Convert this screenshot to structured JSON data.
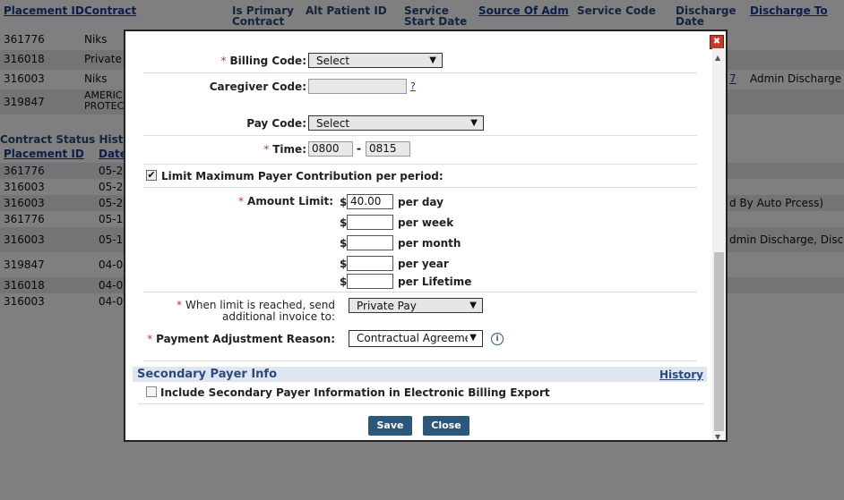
{
  "background": {
    "headers": [
      {
        "text": "Placement ID",
        "link": true
      },
      {
        "text": "Contract",
        "link": true
      },
      {
        "text": "Is Primary Contract",
        "link": false
      },
      {
        "text": "Alt Patient ID",
        "link": false
      },
      {
        "text": "Service Start Date",
        "link": false
      },
      {
        "text": "Source Of Adm",
        "link": true
      },
      {
        "text": "Service Code",
        "link": false
      },
      {
        "text": "Discharge Date",
        "link": false
      },
      {
        "text": "Discharge To",
        "link": true
      }
    ],
    "rows": [
      {
        "id": "361776",
        "contract": "Niks"
      },
      {
        "id": "316018",
        "contract": "Private"
      },
      {
        "id": "316003",
        "contract": "Niks",
        "extra": "7",
        "discharge_to": "Admin Discharge"
      },
      {
        "id": "319847",
        "contract": "AMERIC\nPROTEC"
      }
    ],
    "status_history_title": "Contract Status History",
    "status_headers": [
      "Placement ID",
      "Date"
    ],
    "status_rows": [
      {
        "id": "361776",
        "date": "05-2"
      },
      {
        "id": "316003",
        "date": "05-2"
      },
      {
        "id": "316003",
        "date": "05-2",
        "note": "d By Auto Prcess)"
      },
      {
        "id": "361776",
        "date": "05-1"
      },
      {
        "id": "316003",
        "date": "05-1",
        "note": "dmin Discharge, Disch"
      },
      {
        "id": "319847",
        "date": "04-0"
      },
      {
        "id": "316018",
        "date": "04-0"
      },
      {
        "id": "316003",
        "date": "04-0"
      }
    ]
  },
  "modal": {
    "close_glyph": "✖",
    "billing_code": {
      "label": "Billing Code:",
      "value": "Select"
    },
    "caregiver_code": {
      "label": "Caregiver Code:",
      "value": "",
      "help": "?"
    },
    "pay_code": {
      "label": "Pay Code:",
      "value": "Select"
    },
    "time": {
      "label": "Time:",
      "start": "0800",
      "separator": "-",
      "end": "0815"
    },
    "limit_checkbox": {
      "label": "Limit Maximum Payer Contribution per period:",
      "checked": true
    },
    "amount_limit": {
      "label": "Amount Limit:",
      "currency": "$",
      "rows": [
        {
          "period": "per day",
          "value": "40.00"
        },
        {
          "period": "per week",
          "value": ""
        },
        {
          "period": "per month",
          "value": ""
        },
        {
          "period": "per year",
          "value": ""
        },
        {
          "period": "per Lifetime",
          "value": ""
        }
      ]
    },
    "limit_reached": {
      "label_line1": "When limit is reached, send",
      "label_line2": "additional invoice to:",
      "value": "Private Pay"
    },
    "adjustment_reason": {
      "label": "Payment Adjustment Reason:",
      "value": "Contractual Agreemer"
    },
    "info_glyph": "i",
    "secondary": {
      "title": "Secondary Payer Info",
      "history_link": "History",
      "checkbox_label": "Include Secondary Payer Information in Electronic Billing Export",
      "checked": false
    },
    "save_label": "Save",
    "close_label": "Close",
    "required_mark": "*",
    "colors": {
      "button": "#2b587a",
      "section_bg": "#dfe6f0",
      "section_title": "#2b4a7a",
      "required": "#c0392b",
      "close_bg": "#c0392b"
    }
  }
}
